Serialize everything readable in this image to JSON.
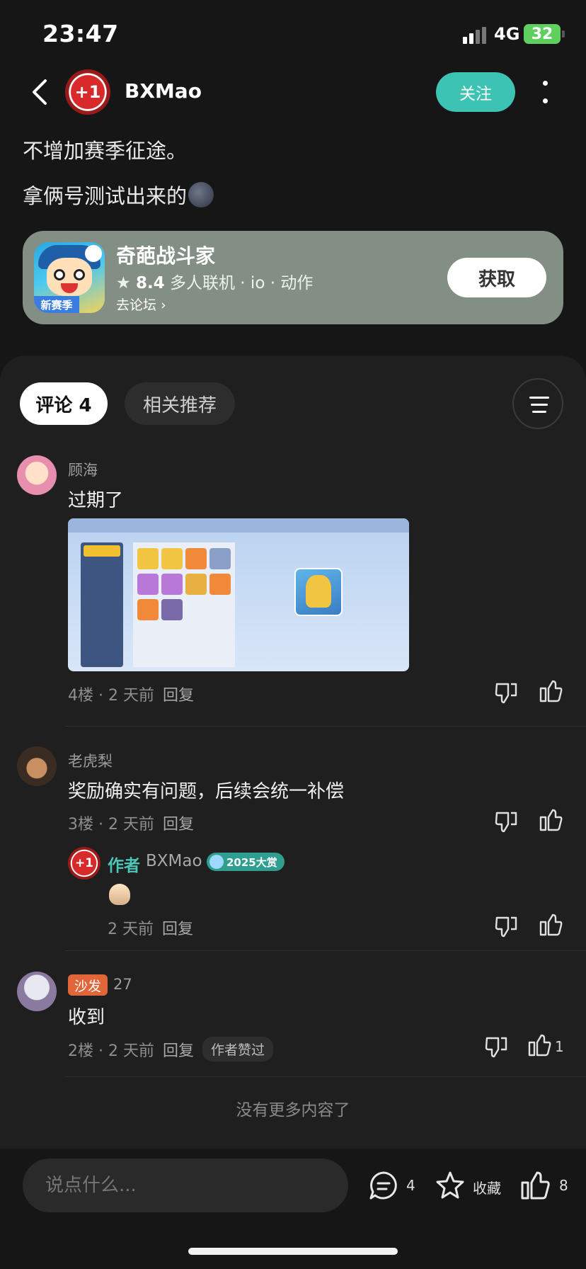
{
  "status": {
    "time": "23:47",
    "network": "4G",
    "battery": "32"
  },
  "header": {
    "author_name": "BXMao",
    "avatar_text": "+1",
    "follow_label": "关注"
  },
  "post": {
    "line1": "不增加赛季征途。",
    "line2": "拿俩号测试出来的"
  },
  "game": {
    "name": "奇葩战斗家",
    "rating": "8.4",
    "tags": "多人联机 · io · 动作",
    "forum_link": "去论坛",
    "icon_ribbon": "新赛季",
    "get_label": "获取"
  },
  "tabs": {
    "comments_label": "评论 4",
    "related_label": "相关推荐"
  },
  "comments": [
    {
      "nick": "顾海",
      "text": "过期了",
      "floor": "4楼",
      "time": "2 天前",
      "reply": "回复"
    },
    {
      "nick": "老虎梨",
      "text": "奖励确实有问题，后续会统一补偿",
      "floor": "3楼",
      "time": "2 天前",
      "reply": "回复",
      "author_reply": {
        "tag": "作者",
        "name": "BXMao",
        "avatar_text": "+1",
        "award": "2025大赏",
        "time": "2 天前",
        "reply": "回复"
      }
    },
    {
      "nick": "27",
      "badge": "沙发",
      "text": "收到",
      "floor": "2楼",
      "time": "2 天前",
      "reply": "回复",
      "author_liked": "作者赞过",
      "likes": "1"
    }
  ],
  "end_text": "没有更多内容了",
  "bottom": {
    "input_placeholder": "说点什么...",
    "comment_count": "4",
    "favorite_label": "收藏",
    "like_count": "8"
  },
  "colors": {
    "accent": "#3cc3b3",
    "card": "#838e84",
    "sofa": "#e0663a",
    "background": "#161616"
  }
}
